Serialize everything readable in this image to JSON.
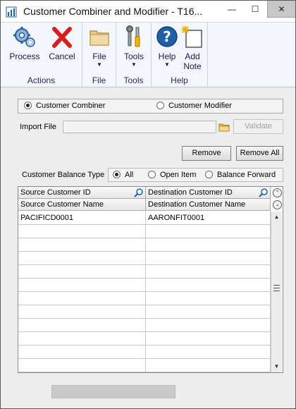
{
  "window": {
    "title": "Customer Combiner and Modifier  -  T16...",
    "min_glyph": "—",
    "max_glyph": "☐",
    "close_glyph": "✕"
  },
  "ribbon": {
    "groups": [
      {
        "name": "Actions",
        "buttons": [
          {
            "label": "Process",
            "icon": "gears-icon"
          },
          {
            "label": "Cancel",
            "icon": "red-x-icon"
          }
        ]
      },
      {
        "name": "File",
        "buttons": [
          {
            "label": "File",
            "icon": "folder-icon",
            "dropdown": true
          }
        ]
      },
      {
        "name": "Tools",
        "buttons": [
          {
            "label": "Tools",
            "icon": "tools-icon",
            "dropdown": true
          }
        ]
      },
      {
        "name": "Help",
        "buttons": [
          {
            "label": "Help",
            "icon": "help-icon",
            "dropdown": true
          },
          {
            "label": "Add Note",
            "icon": "note-icon"
          }
        ]
      }
    ],
    "add_note_line1": "Add",
    "add_note_line2": "Note",
    "dropdown_glyph": "▼"
  },
  "mode": {
    "options": [
      "Customer Combiner",
      "Customer Modifier"
    ],
    "selected": "Customer Combiner"
  },
  "import": {
    "label": "Import File",
    "value": "",
    "validate_label": "Validate"
  },
  "actions": {
    "remove_label": "Remove",
    "remove_all_label": "Remove All"
  },
  "balance_type": {
    "label": "Customer Balance Type",
    "options": [
      "All",
      "Open Item",
      "Balance Forward"
    ],
    "selected": "All"
  },
  "grid": {
    "headers_row1": [
      "Source Customer ID",
      "Destination Customer ID"
    ],
    "headers_row2": [
      "Source Customer Name",
      "Destination Customer Name"
    ],
    "rows": [
      [
        "PACIFICD0001",
        "AARONFIT0001"
      ],
      [
        "",
        ""
      ],
      [
        "",
        ""
      ],
      [
        "",
        ""
      ],
      [
        "",
        ""
      ],
      [
        "",
        ""
      ],
      [
        "",
        ""
      ],
      [
        "",
        ""
      ],
      [
        "",
        ""
      ],
      [
        "",
        ""
      ],
      [
        "",
        ""
      ],
      [
        "",
        ""
      ]
    ]
  },
  "colors": {
    "accent": "#1f5fa8",
    "cancel_red": "#d32020"
  }
}
